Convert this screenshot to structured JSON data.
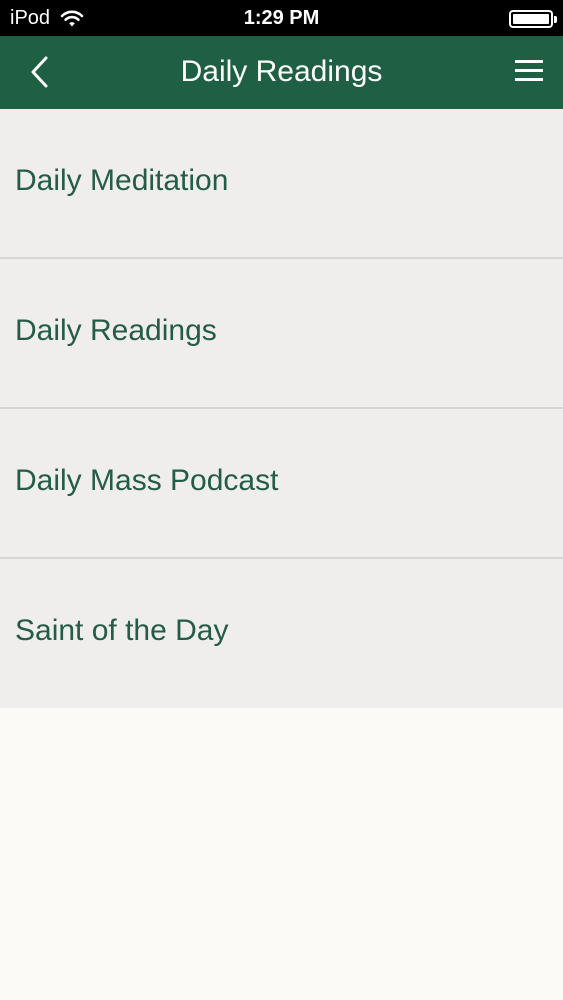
{
  "status_bar": {
    "carrier": "iPod",
    "time": "1:29 PM"
  },
  "nav": {
    "title": "Daily Readings"
  },
  "menu_items": [
    {
      "label": "Daily Meditation"
    },
    {
      "label": "Daily Readings"
    },
    {
      "label": "Daily Mass Podcast"
    },
    {
      "label": "Saint of the Day"
    }
  ],
  "colors": {
    "nav_background": "#1f5f44",
    "item_text": "#245c45",
    "list_background": "#efeeed",
    "page_background": "#fbfaf6"
  },
  "icons": [
    "wifi-icon",
    "battery-icon",
    "back-chevron-icon",
    "hamburger-menu-icon"
  ]
}
